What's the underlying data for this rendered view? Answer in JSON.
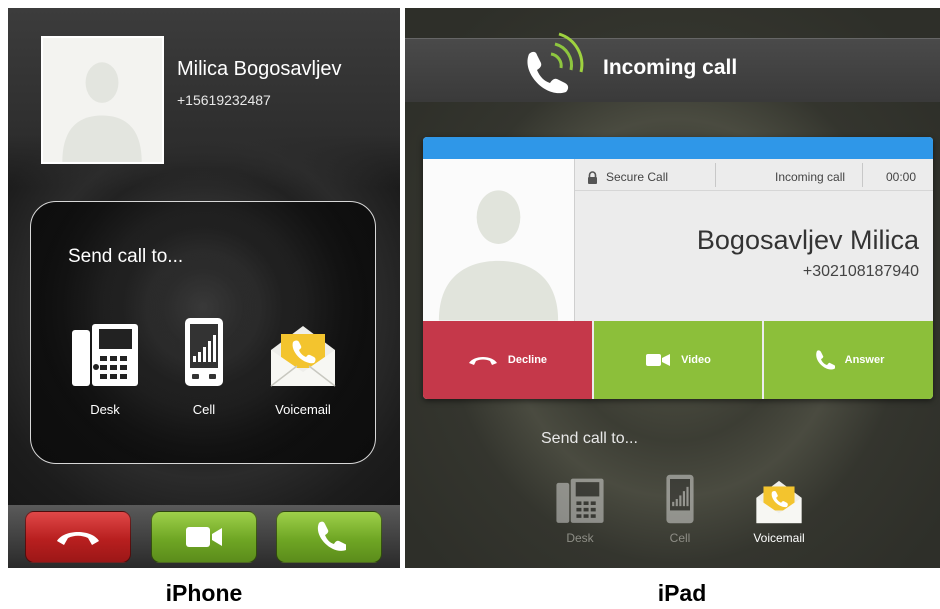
{
  "iphone": {
    "contact_name": "Milica Bogosavljev",
    "contact_number": "+15619232487",
    "send_call_title": "Send call to...",
    "options": [
      {
        "label": "Desk",
        "icon": "desk-phone-icon"
      },
      {
        "label": "Cell",
        "icon": "cell-phone-icon"
      },
      {
        "label": "Voicemail",
        "icon": "voicemail-envelope-icon"
      }
    ],
    "buttons": [
      {
        "action": "decline",
        "icon": "hangup-icon",
        "color": "#c92a2a"
      },
      {
        "action": "video",
        "icon": "video-camera-icon",
        "color": "#7cb32e"
      },
      {
        "action": "answer",
        "icon": "phone-handset-icon",
        "color": "#7cb32e"
      }
    ]
  },
  "ipad": {
    "header_title": "Incoming call",
    "secure_label": "Secure Call",
    "call_state": "Incoming call",
    "timer": "00:00",
    "contact_name": "Bogosavljev Milica",
    "contact_number": "+302108187940",
    "actions": {
      "decline": "Decline",
      "video": "Video",
      "answer": "Answer"
    },
    "send_call_title": "Send call to...",
    "options": [
      {
        "label": "Desk",
        "icon": "desk-phone-icon"
      },
      {
        "label": "Cell",
        "icon": "cell-phone-icon"
      },
      {
        "label": "Voicemail",
        "icon": "voicemail-envelope-icon"
      }
    ],
    "colors": {
      "accent_blue": "#2f97e8",
      "decline_red": "#c5384a",
      "answer_green": "#8cbf3a"
    }
  },
  "captions": {
    "iphone": "iPhone",
    "ipad": "iPad"
  }
}
